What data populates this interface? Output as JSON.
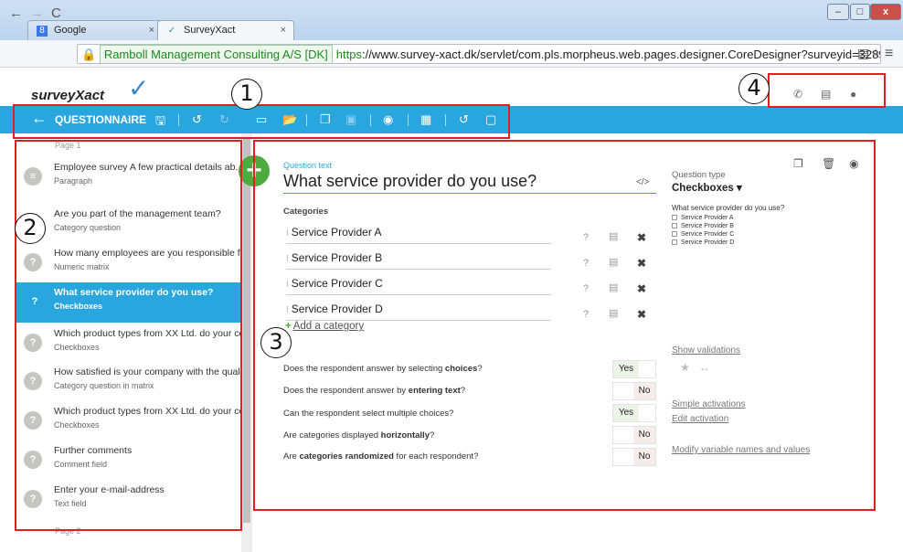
{
  "browser": {
    "tabs": [
      {
        "label": "Google",
        "favicon": "google-icon"
      },
      {
        "label": "SurveyXact",
        "favicon": "check-icon"
      }
    ],
    "ev_cert": "Ramboll Management Consulting A/S [DK]",
    "url_scheme": "https",
    "url_rest": "://www.survey-xact.dk/servlet/com.pls.morpheus.web.pages.designer.CoreDesigner?surveyid=3289"
  },
  "app": {
    "logo": "surveyXact",
    "toolbar": {
      "title": "QUESTIONNAIRE"
    }
  },
  "sidebar": {
    "page_top": "Page 1",
    "page_bottom": "Page 2",
    "items": [
      {
        "title": "Employee survey   A few practical details ab...",
        "type": "Paragraph",
        "icon": "≡"
      },
      {
        "title": "Are you part of the management team?",
        "type": "Category question",
        "icon": "?"
      },
      {
        "title": "How many employees are you responsible f...",
        "type": "Numeric matrix",
        "icon": "?"
      },
      {
        "title": "What service provider do you use?",
        "type": "Checkboxes",
        "icon": "?"
      },
      {
        "title": "Which product types from XX Ltd. do your co...",
        "type": "Checkboxes",
        "icon": "?"
      },
      {
        "title": "How satisfied is your company with the quali...",
        "type": "Category question in matrix",
        "icon": "?"
      },
      {
        "title": "Which product types from XX Ltd. do your co...",
        "type": "Checkboxes",
        "icon": "?"
      },
      {
        "title": "Further comments",
        "type": "Comment field",
        "icon": "?"
      },
      {
        "title": "Enter your e-mail-address",
        "type": "Text field",
        "icon": "?"
      }
    ]
  },
  "editor": {
    "question_label": "Question text",
    "question_text": "What service provider do you use?",
    "categories_label": "Categories",
    "categories": [
      "Service Provider A",
      "Service Provider B",
      "Service Provider C",
      "Service Provider D"
    ],
    "add_category": "Add a category",
    "options": [
      {
        "pre": "Does the respondent answer by selecting ",
        "bold": "choices",
        "post": "?",
        "value": "Yes"
      },
      {
        "pre": "Does the respondent answer by ",
        "bold": "entering text",
        "post": "?",
        "value": "No"
      },
      {
        "pre": "Can the respondent select multiple choices?",
        "bold": "",
        "post": "",
        "value": "Yes"
      },
      {
        "pre": "Are categories displayed ",
        "bold": "horizontally",
        "post": "?",
        "value": "No"
      },
      {
        "pre": "Are ",
        "bold": "categories randomized",
        "post": " for each respondent?",
        "value": "No"
      }
    ],
    "yes_label": "Yes",
    "no_label": "No"
  },
  "right_panel": {
    "question_type_label": "Question type",
    "question_type_value": "Checkboxes ▾",
    "preview_question": "What service provider do you use?",
    "preview_options": [
      "Service Provider A",
      "Service Provider B",
      "Service Provider C",
      "Service Provider D"
    ],
    "show_validations": "Show validations",
    "simple_activations": "Simple activations",
    "edit_activation": "Edit activation",
    "modify_variables": "Modify variable names and values"
  },
  "annotations": [
    "1",
    "2",
    "3",
    "4"
  ],
  "colors": {
    "accent": "#2aa6df",
    "add": "#4caa3e",
    "annotation": "#e02020"
  }
}
